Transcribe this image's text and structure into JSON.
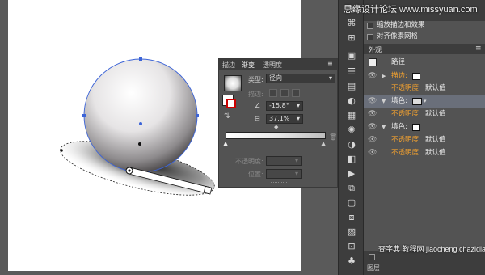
{
  "watermark_top": "思缘设计论坛  www.missyuan.com",
  "watermark_bottom": "查字典 教程网  jiaocheng.chazidian.com",
  "gradient_panel": {
    "tabs": [
      "描边",
      "渐变",
      "透明度"
    ],
    "type_label": "类型:",
    "type_value": "径向",
    "stroke_label": "描边:",
    "angle_value": "-15.8°",
    "aspect_value": "37.1%",
    "opacity_label": "不透明度:",
    "position_label": "位置:"
  },
  "top_options": {
    "scale_strokes": "缩放描边和效果",
    "align_pixel_grid": "对齐像素网格"
  },
  "appearance_panel": {
    "tab": "外观",
    "title": "路径",
    "rows": [
      {
        "label": "描边:",
        "color": "orange"
      },
      {
        "label": "不透明度:",
        "value": "默认值"
      },
      {
        "label": "填色:",
        "color": "white"
      },
      {
        "label": "不透明度:",
        "value": "默认值"
      },
      {
        "label": "填色:",
        "color": "white"
      },
      {
        "label": "不透明度:",
        "value": "默认值"
      },
      {
        "label": "不透明度:",
        "value": "默认值"
      }
    ],
    "bottom_label": "图层"
  },
  "colors": {
    "accent_orange": "#f0a030",
    "selection_blue": "#3c64d8"
  }
}
